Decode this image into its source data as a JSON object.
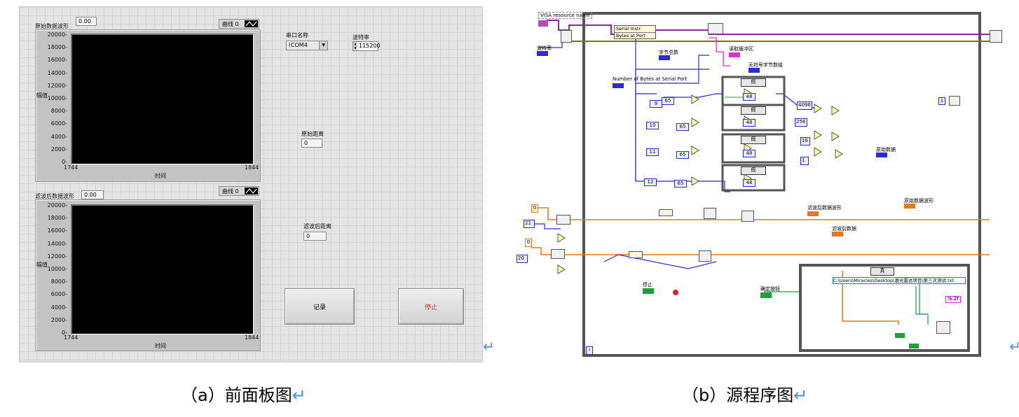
{
  "front_panel": {
    "graph1": {
      "title": "原始数据波形",
      "value": "0.00",
      "legend": "曲线 0",
      "y_ticks": [
        "20000",
        "18000",
        "16000",
        "14000",
        "12000",
        "10000",
        "8000",
        "6000",
        "4000",
        "2000",
        "0"
      ],
      "x_min": "1744",
      "x_max": "1844",
      "xlabel": "时间",
      "ylabel": "幅值"
    },
    "graph2": {
      "title": "滤波后数据波形",
      "value": "0.00",
      "legend": "曲线 0",
      "y_ticks": [
        "20000",
        "18000",
        "16000",
        "14000",
        "12000",
        "10000",
        "8000",
        "6000",
        "4000",
        "2000",
        "0"
      ],
      "x_min": "1744",
      "x_max": "1844",
      "xlabel": "时间",
      "ylabel": "幅值"
    },
    "serial_port": {
      "label": "串口名称",
      "value": "COM4"
    },
    "baud_rate": {
      "label": "波特率",
      "value": "115200"
    },
    "raw_distance": {
      "label": "原始距离",
      "value": "0"
    },
    "filtered_distance": {
      "label": "滤波后距离",
      "value": "0"
    },
    "record_button": "记录",
    "stop_button": "停止"
  },
  "block_diagram": {
    "visa_label": "VISA resource name",
    "baud_label": "波特率",
    "property_class": "Serial Instr",
    "property_name": "Bytes at Port",
    "byte_count_label": "字节总数",
    "read_buffer_label": "读取缓冲区",
    "unsigned_array_label": "无符号字节数组",
    "bytes_at_port_label": "Number of Bytes at Serial Port",
    "index_consts": [
      "9",
      "10",
      "11",
      "12"
    ],
    "const_65": "65",
    "const_48": "48",
    "case_label_false": "假",
    "case_label_true": "真",
    "multipliers": [
      "4096",
      "256",
      "16",
      "1"
    ],
    "raw_data_label": "原始数据",
    "raw_wave_label": "原始数据波形",
    "filtered_wave_label": "滤波后数据波形",
    "filtered_data_label": "滤波后数据",
    "const_0a": "0",
    "const_21": "21",
    "const_0b": "0",
    "const_20": "20",
    "stop_label": "停止",
    "confirm_label": "确定按钮",
    "file_path": "C:\\Users\\Miracles\\Desktop\\激光雷达项目\\第三次测试.txt",
    "format_string": "%.2f",
    "loop_index": "i",
    "const_1": "1"
  },
  "captions": {
    "a": "（a）前面板图",
    "b": "（b）源程序图",
    "return_mark": "↵"
  },
  "colors": {
    "wire_blue": "#2b2bd6",
    "wire_orange": "#e07a1a",
    "wire_pink": "#e22fd3",
    "wire_green": "#1f9e3a",
    "wire_olive": "#7a7a00",
    "wire_purple": "#8a2b9e",
    "stop_text": "#e02020"
  }
}
